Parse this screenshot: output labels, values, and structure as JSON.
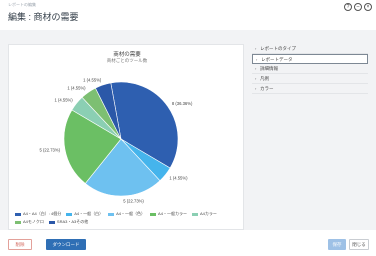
{
  "window": {
    "breadcrumb": "レポートの編集",
    "title": "編集 : 商材の需要",
    "buttons": {
      "help": "?",
      "minimize": "–",
      "close": "×"
    }
  },
  "side_panel": {
    "items": [
      {
        "label": "レポートのタイプ",
        "active": false
      },
      {
        "label": "レポートデータ",
        "active": true
      },
      {
        "label": "詳細情報",
        "active": false
      },
      {
        "label": "凡例",
        "active": false
      },
      {
        "label": "カラー",
        "active": false
      }
    ]
  },
  "footer": {
    "cancel_label": "削除",
    "download_label": "ダウンロード",
    "save_label": "保存",
    "close_label": "閉じる"
  },
  "chart_data": {
    "type": "pie",
    "title": "商材の需要",
    "subtitle": "商材ごとのツール数",
    "slices": [
      {
        "label": "8 (36.36%)",
        "value": 8,
        "color": "#2e5fb0",
        "legend": "A4・A4（白）: 4個分"
      },
      {
        "label": "1 (4.55%)",
        "value": 1,
        "color": "#45b4ec",
        "legend": "A4・一般（白）"
      },
      {
        "label": "5 (22.73%)",
        "value": 5,
        "color": "#6ec1f0",
        "legend": "A4・一般（色）"
      },
      {
        "label": "5 (22.73%)",
        "value": 5,
        "color": "#6bbf64",
        "legend": "A4・一般カラー"
      },
      {
        "label": "1 (4.55%)",
        "value": 1,
        "color": "#8bcfb3",
        "legend": "A4カラー"
      },
      {
        "label": "1 (4.55%)",
        "value": 1,
        "color": "#7dbf72",
        "legend": "A4モノクロ"
      },
      {
        "label": "1 (4.55%)",
        "value": 1,
        "color": "#2b58a8",
        "legend": "SRA3・A3その他"
      }
    ]
  }
}
